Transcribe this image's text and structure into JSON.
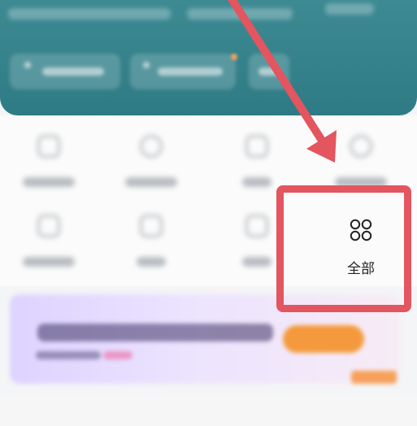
{
  "grid": {
    "all_button": {
      "label": "全部",
      "icon": "four-circles-icon"
    }
  },
  "annotation": {
    "color": "#e3555f"
  },
  "colors": {
    "header": "#2f7b85",
    "promo_button": "#f59a3c"
  }
}
